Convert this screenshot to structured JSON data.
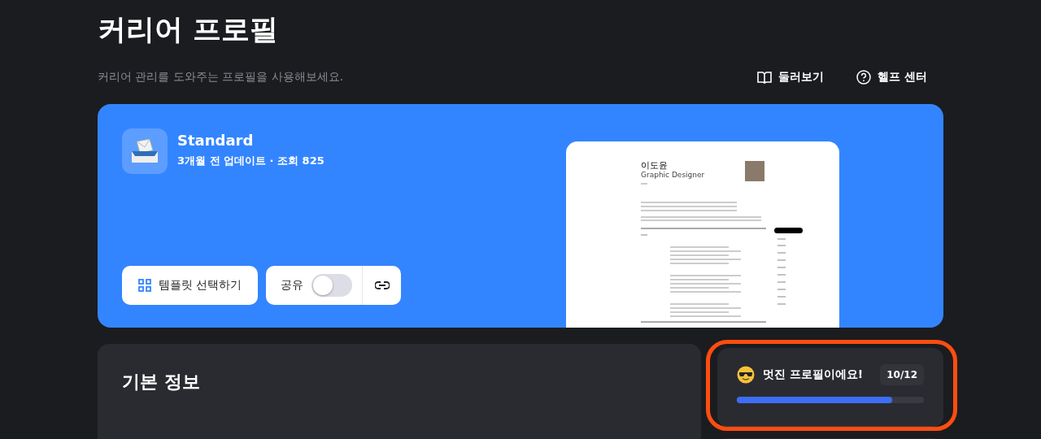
{
  "header": {
    "title": "커리어 프로필",
    "subtitle": "커리어 관리를 도와주는 프로필을 사용해보세요.",
    "links": [
      {
        "kind": "book",
        "label": "둘러보기"
      },
      {
        "kind": "help",
        "label": "헬프 센터"
      }
    ]
  },
  "profile_card": {
    "name": "Standard",
    "meta": "3개월 전 업데이트 · 조회 825",
    "template_button": "템플릿 선택하기",
    "share": {
      "label": "공유",
      "on": false
    },
    "preview": {
      "name": "이도윤",
      "role": "Graphic Designer"
    }
  },
  "basic_info": {
    "title": "기본 정보"
  },
  "completion": {
    "message": "멋진 프로필이에요!",
    "count": "10/12",
    "level": 0.83,
    "highlighted": true
  }
}
